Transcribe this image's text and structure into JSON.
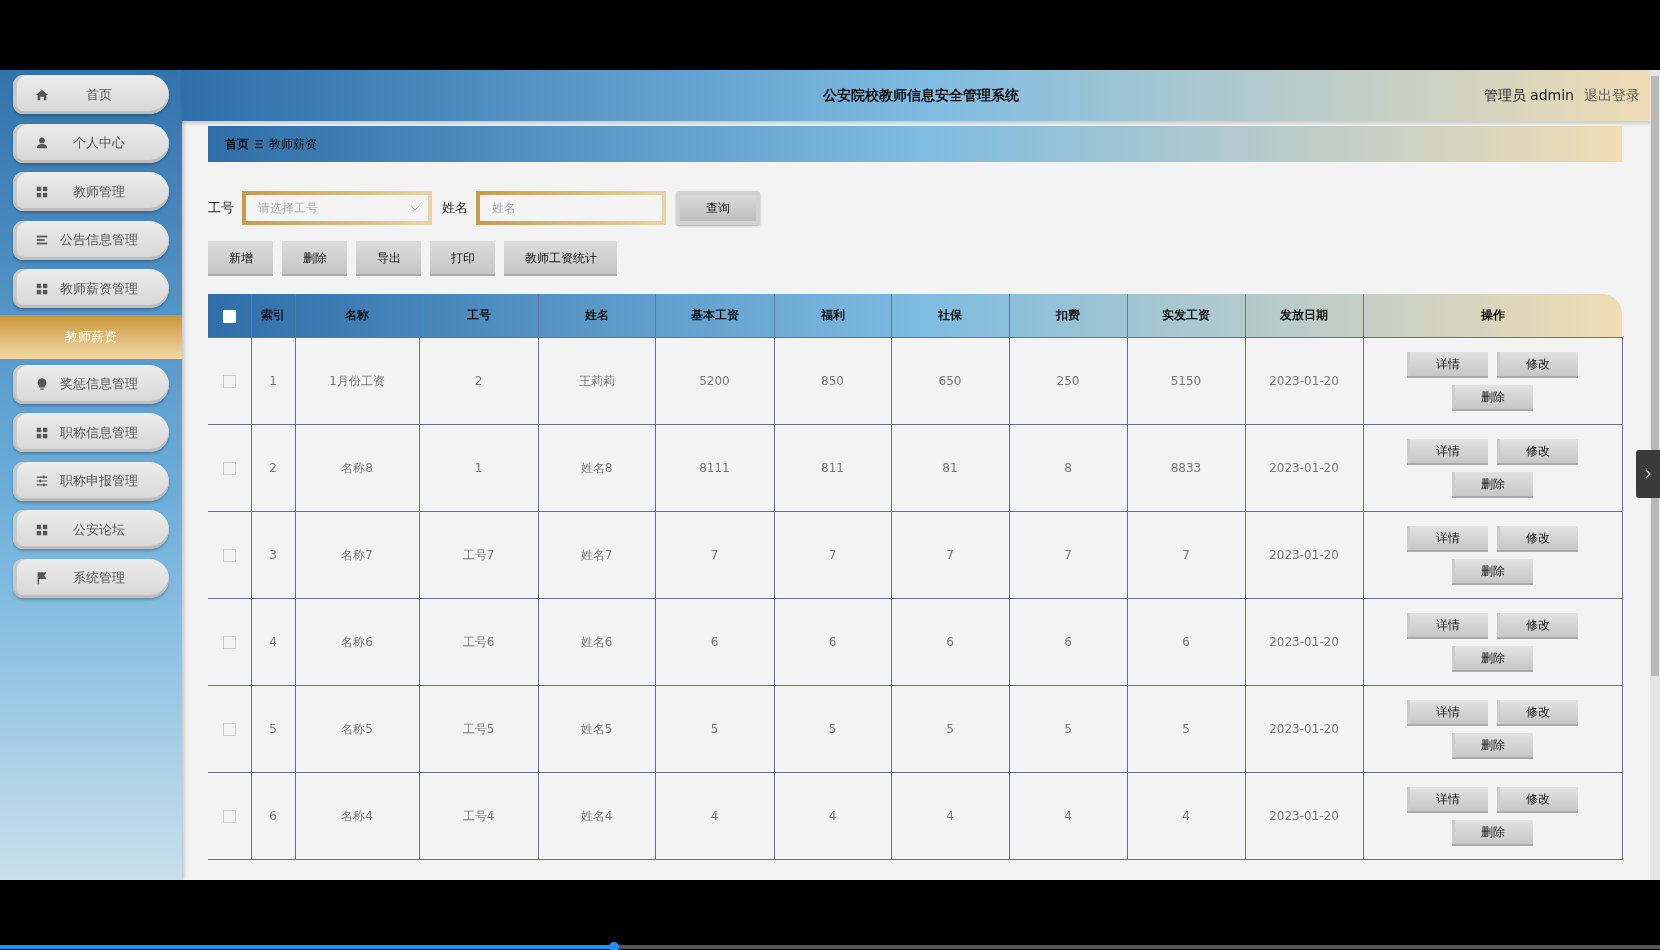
{
  "player": {
    "level": 0.37
  },
  "sidebar": {
    "items": [
      {
        "label": "首页",
        "kind": "menu",
        "selected": false
      },
      {
        "label": "个人中心",
        "kind": "menu",
        "selected": false
      },
      {
        "label": "教师管理",
        "kind": "menu",
        "selected": false
      },
      {
        "label": "公告信息管理",
        "kind": "menu",
        "selected": false
      },
      {
        "label": "教师薪资管理",
        "kind": "menu",
        "selected": false
      },
      {
        "label": "教师薪资",
        "kind": "submenu",
        "selected": true
      },
      {
        "label": "奖惩信息管理",
        "kind": "menu",
        "selected": false
      },
      {
        "label": "职称信息管理",
        "kind": "menu",
        "selected": false
      },
      {
        "label": "职称申报管理",
        "kind": "menu",
        "selected": false
      },
      {
        "label": "公安论坛",
        "kind": "menu",
        "selected": false
      },
      {
        "label": "系统管理",
        "kind": "menu",
        "selected": false
      }
    ]
  },
  "header": {
    "title": "公安院校教师信息安全管理系统",
    "user": "管理员 admin",
    "logout": "退出登录"
  },
  "breadcrumb": [
    "首页",
    "教师薪资"
  ],
  "search": {
    "fields": [
      {
        "label": "工号",
        "kind": "select",
        "placeholder": "请选择工号"
      },
      {
        "label": "姓名",
        "kind": "text",
        "placeholder": "姓名"
      }
    ],
    "button": "查询"
  },
  "actions": [
    "新增",
    "删除",
    "导出",
    "打印",
    "教师工资统计"
  ],
  "table": {
    "all_checked": false,
    "columns": [
      "索引",
      "名称",
      "工号",
      "姓名",
      "基本工资",
      "福利",
      "社保",
      "扣费",
      "实发工资",
      "发放日期",
      "操作"
    ],
    "rows": [
      {
        "checked": false,
        "cells": [
          "1",
          "1月份工资",
          "2",
          "王莉莉",
          "5200",
          "850",
          "650",
          "250",
          "5150",
          "2023-01-20"
        ],
        "actions": [
          "详情",
          "修改",
          "删除"
        ]
      },
      {
        "checked": false,
        "cells": [
          "2",
          "名称8",
          "1",
          "姓名8",
          "8111",
          "811",
          "81",
          "8",
          "8833",
          "2023-01-20"
        ],
        "actions": [
          "详情",
          "修改",
          "删除"
        ]
      },
      {
        "checked": false,
        "cells": [
          "3",
          "名称7",
          "工号7",
          "姓名7",
          "7",
          "7",
          "7",
          "7",
          "7",
          "2023-01-20"
        ],
        "actions": [
          "详情",
          "修改",
          "删除"
        ]
      },
      {
        "checked": false,
        "cells": [
          "4",
          "名称6",
          "工号6",
          "姓名6",
          "6",
          "6",
          "6",
          "6",
          "6",
          "2023-01-20"
        ],
        "actions": [
          "详情",
          "修改",
          "删除"
        ]
      },
      {
        "checked": false,
        "cells": [
          "5",
          "名称5",
          "工号5",
          "姓名5",
          "5",
          "5",
          "5",
          "5",
          "5",
          "2023-01-20"
        ],
        "actions": [
          "详情",
          "修改",
          "删除"
        ]
      },
      {
        "checked": false,
        "cells": [
          "6",
          "名称4",
          "工号4",
          "姓名4",
          "4",
          "4",
          "4",
          "4",
          "4",
          "2023-01-20"
        ],
        "actions": [
          "详情",
          "修改",
          "删除"
        ]
      }
    ]
  }
}
